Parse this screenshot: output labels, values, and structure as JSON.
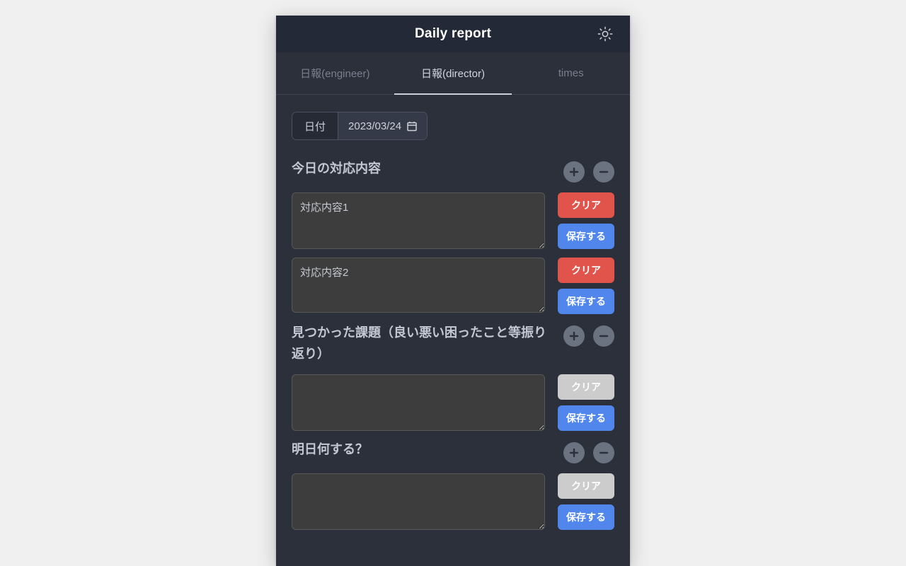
{
  "header": {
    "title": "Daily report",
    "theme_toggle_icon": "sun-icon"
  },
  "tabs": [
    {
      "label": "日報(engineer)",
      "active": false
    },
    {
      "label": "日報(director)",
      "active": true
    },
    {
      "label": "times",
      "active": false
    }
  ],
  "date_field": {
    "label": "日付",
    "value": "2023/03/24",
    "icon": "calendar-icon"
  },
  "buttons": {
    "clear_label": "クリア",
    "save_label": "保存する",
    "add_icon": "plus-circle-icon",
    "remove_icon": "minus-circle-icon"
  },
  "colors": {
    "page_background": "#f0f0f0",
    "app_background": "#2b303b",
    "header_background": "#232936",
    "textarea_background": "#3d3d3d",
    "clear_red": "#e0544c",
    "clear_disabled_gray": "#cccccc",
    "save_blue": "#5186ec",
    "round_button_gray": "#6b7280",
    "active_tab_underline": "#c9ced8"
  },
  "sections": [
    {
      "title": "今日の対応内容",
      "entries": [
        {
          "value": "対応内容1",
          "placeholder": "",
          "clear_enabled": true
        },
        {
          "value": "対応内容2",
          "placeholder": "",
          "clear_enabled": true
        }
      ]
    },
    {
      "title": "見つかった課題（良い悪い困ったこと等振り返り）",
      "entries": [
        {
          "value": "",
          "placeholder": "",
          "clear_enabled": false
        }
      ]
    },
    {
      "title": "明日何する？",
      "entries": [
        {
          "value": "",
          "placeholder": "",
          "clear_enabled": false
        }
      ]
    }
  ]
}
